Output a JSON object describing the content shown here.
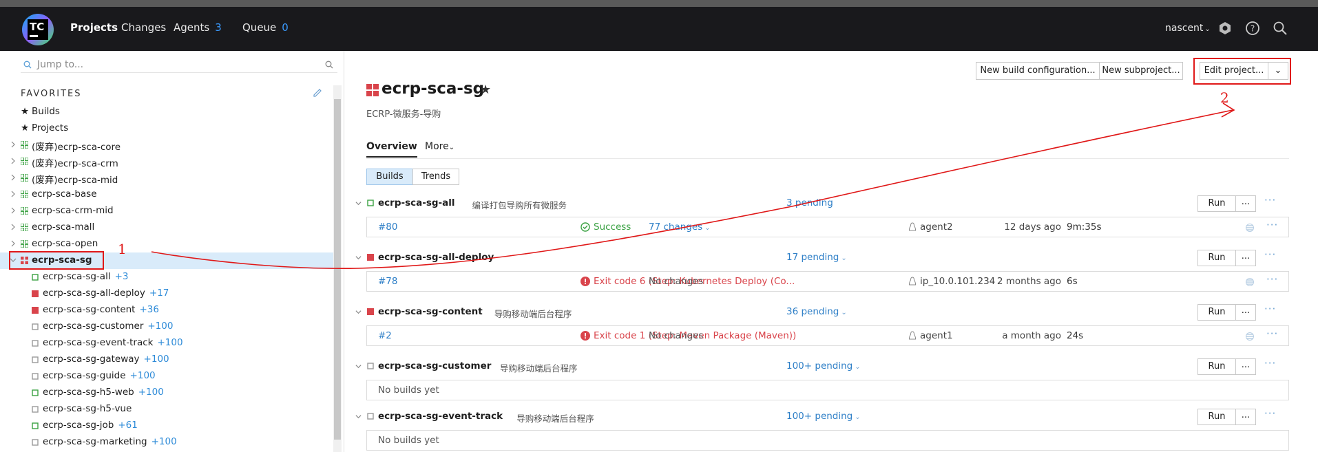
{
  "header": {
    "logo_text": "TC",
    "nav": [
      {
        "label": "Projects",
        "active": true
      },
      {
        "label": "Changes"
      },
      {
        "label": "Agents",
        "count": "3"
      },
      {
        "label": "Queue",
        "count": "0"
      }
    ],
    "user": "nascent",
    "icons": [
      "settings-icon",
      "help-icon",
      "search-icon"
    ]
  },
  "sidebar": {
    "search_placeholder": "Jump to...",
    "favorites_heading": "FAVORITES",
    "favorites": [
      {
        "label": "Builds"
      },
      {
        "label": "Projects"
      }
    ],
    "projects": [
      {
        "label": "(废弃)ecrp-sca-core"
      },
      {
        "label": "(废弃)ecrp-sca-crm"
      },
      {
        "label": "(废弃)ecrp-sca-mid"
      },
      {
        "label": "ecrp-sca-base"
      },
      {
        "label": "ecrp-sca-crm-mid"
      },
      {
        "label": "ecrp-sca-mall"
      },
      {
        "label": "ecrp-sca-open"
      },
      {
        "label": "ecrp-sca-sg",
        "selected": true
      }
    ],
    "children": [
      {
        "label": "ecrp-sca-sg-all",
        "count": "+3",
        "status": "success"
      },
      {
        "label": "ecrp-sca-sg-all-deploy",
        "count": "+17",
        "status": "failed"
      },
      {
        "label": "ecrp-sca-sg-content",
        "count": "+36",
        "status": "failed"
      },
      {
        "label": "ecrp-sca-sg-customer",
        "count": "+100",
        "status": "none"
      },
      {
        "label": "ecrp-sca-sg-event-track",
        "count": "+100",
        "status": "none"
      },
      {
        "label": "ecrp-sca-sg-gateway",
        "count": "+100",
        "status": "none"
      },
      {
        "label": "ecrp-sca-sg-guide",
        "count": "+100",
        "status": "none"
      },
      {
        "label": "ecrp-sca-sg-h5-web",
        "count": "+100",
        "status": "success"
      },
      {
        "label": "ecrp-sca-sg-h5-vue",
        "count": "",
        "status": "none"
      },
      {
        "label": "ecrp-sca-sg-job",
        "count": "+61",
        "status": "success"
      },
      {
        "label": "ecrp-sca-sg-marketing",
        "count": "+100",
        "status": "none"
      }
    ]
  },
  "annotations": {
    "marker1": "1",
    "marker2": "2"
  },
  "main": {
    "toolbar": {
      "new_build_config": "New build configuration...",
      "new_subproject": "New subproject...",
      "edit_project": "Edit project...",
      "dropdown": "⌄"
    },
    "title": "ecrp-sca-sg",
    "subtitle": "ECRP-微服务-导购",
    "tabs": [
      {
        "label": "Overview",
        "active": true
      },
      {
        "label": "More"
      }
    ],
    "view_toggle": [
      {
        "label": "Builds",
        "active": true
      },
      {
        "label": "Trends"
      }
    ],
    "run_label": "Run",
    "more_label": "...",
    "build_types": [
      {
        "name": "ecrp-sca-sg-all",
        "desc": "编译打包导购所有微服务",
        "pending": "3 pending",
        "status": "success",
        "build": {
          "number": "#80",
          "status_text": "Success",
          "changes": "77 changes",
          "agent": "agent2",
          "ago": "12 days ago",
          "duration": "9m:35s"
        }
      },
      {
        "name": "ecrp-sca-sg-all-deploy",
        "desc": "",
        "pending": "17 pending",
        "status": "failed",
        "build": {
          "number": "#78",
          "status_text": "Exit code 6 (Step: Kubernetes Deploy (Co...",
          "changes": "No changes",
          "agent": "ip_10.0.101.234",
          "ago": "2 months ago",
          "duration": "6s"
        }
      },
      {
        "name": "ecrp-sca-sg-content",
        "desc": "导购移动端后台程序",
        "pending": "36 pending",
        "status": "failed",
        "build": {
          "number": "#2",
          "status_text": "Exit code 1 (Step: Maven Package (Maven))",
          "changes": "No changes",
          "agent": "agent1",
          "ago": "a month ago",
          "duration": "24s"
        }
      },
      {
        "name": "ecrp-sca-sg-customer",
        "desc": "导购移动端后台程序",
        "pending": "100+ pending",
        "status": "none",
        "no_builds": "No builds yet"
      },
      {
        "name": "ecrp-sca-sg-event-track",
        "desc": "导购移动端后台程序",
        "pending": "100+ pending",
        "status": "none",
        "no_builds": "No builds yet"
      }
    ]
  },
  "colors": {
    "header_bg": "#19191c",
    "link": "#2e7fc7",
    "success": "#3aa142",
    "failed": "#d9444b",
    "annotation": "#e01818"
  }
}
